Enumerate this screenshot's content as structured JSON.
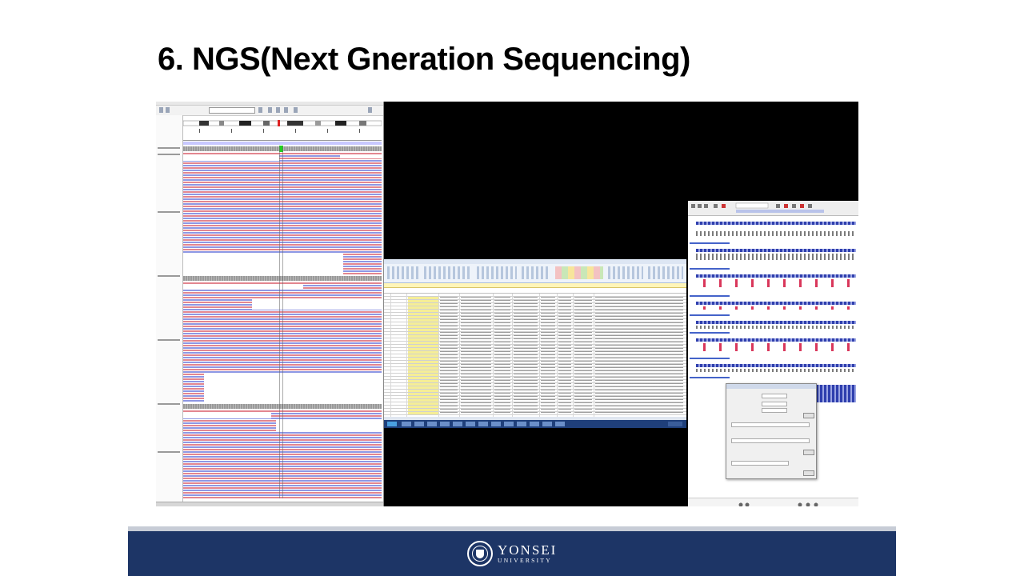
{
  "slide": {
    "title": "6. NGS(Next Gneration Sequencing)"
  },
  "screenshots": [
    {
      "name": "genome-browser",
      "description_color": "#e3868f"
    },
    {
      "name": "spreadsheet",
      "description_color": "#1f3f7a"
    },
    {
      "name": "sequence-viewer",
      "description_color": "#2f3fae"
    }
  ],
  "footer": {
    "institution": "YONSEI",
    "subtitle": "UNIVERSITY",
    "bar_color": "#1d3566",
    "logo_icon": "university-seal-icon"
  },
  "colors": {
    "forward_read": "#e3868f",
    "reverse_read": "#8d97e4",
    "variant": "#1fd11f",
    "sequence_track": "#2f3fae",
    "annotation_marks": "#d9365a"
  }
}
